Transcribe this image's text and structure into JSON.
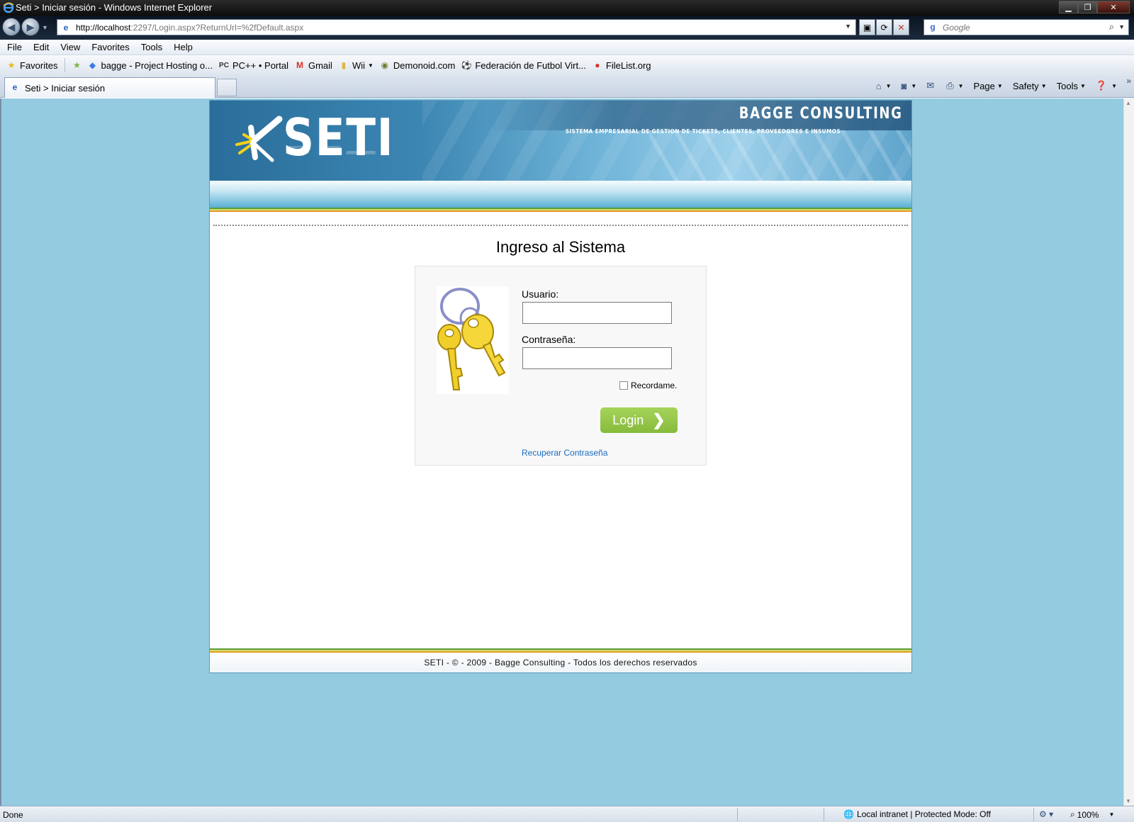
{
  "window": {
    "title": "Seti > Iniciar sesión - Windows Internet Explorer",
    "controls": [
      "minimize",
      "maximize",
      "close"
    ]
  },
  "address": {
    "url_host": "http://localhost",
    "url_rest": ":2297/Login.aspx?ReturnUrl=%2fDefault.aspx",
    "search_placeholder": "Google"
  },
  "menu": [
    "File",
    "Edit",
    "View",
    "Favorites",
    "Tools",
    "Help"
  ],
  "favorites": {
    "label": "Favorites",
    "items": [
      {
        "label": "bagge - Project Hosting o...",
        "icon": "google-code-icon"
      },
      {
        "label": "PC++ • Portal",
        "icon": "pc-icon"
      },
      {
        "label": "Gmail",
        "icon": "gmail-icon"
      },
      {
        "label": "Wii",
        "icon": "folder-icon"
      },
      {
        "label": "Demonoid.com",
        "icon": "demonoid-icon"
      },
      {
        "label": "Federación de Futbol Virt...",
        "icon": "soccer-ball-icon"
      },
      {
        "label": "FileList.org",
        "icon": "filelist-icon"
      }
    ]
  },
  "tab": {
    "label": "Seti > Iniciar sesión"
  },
  "commandbar": {
    "page": "Page",
    "safety": "Safety",
    "tools": "Tools"
  },
  "page": {
    "brand": "BAGGE CONSULTING",
    "logo": "SETI",
    "tagline": "SISTEMA EMPRESARIAL DE GESTION DE TICKETS, CLIENTES, PROVEEDORES E INSUMOS",
    "login_title": "Ingreso al Sistema",
    "user_label": "Usuario:",
    "user_value": "",
    "password_label": "Contraseña:",
    "password_value": "",
    "remember_label": "Recordame.",
    "remember_checked": false,
    "login_button": "Login",
    "recover_link": "Recuperar Contraseña",
    "footer": "SETI - © - 2009 - Bagge Consulting - Todos los derechos reservados"
  },
  "status": {
    "left": "Done",
    "zone": "Local intranet | Protected Mode: Off",
    "zoom": "100%"
  },
  "colors": {
    "page_background": "#94cbe0",
    "login_button": "#94c548",
    "link": "#1a6bbf"
  }
}
